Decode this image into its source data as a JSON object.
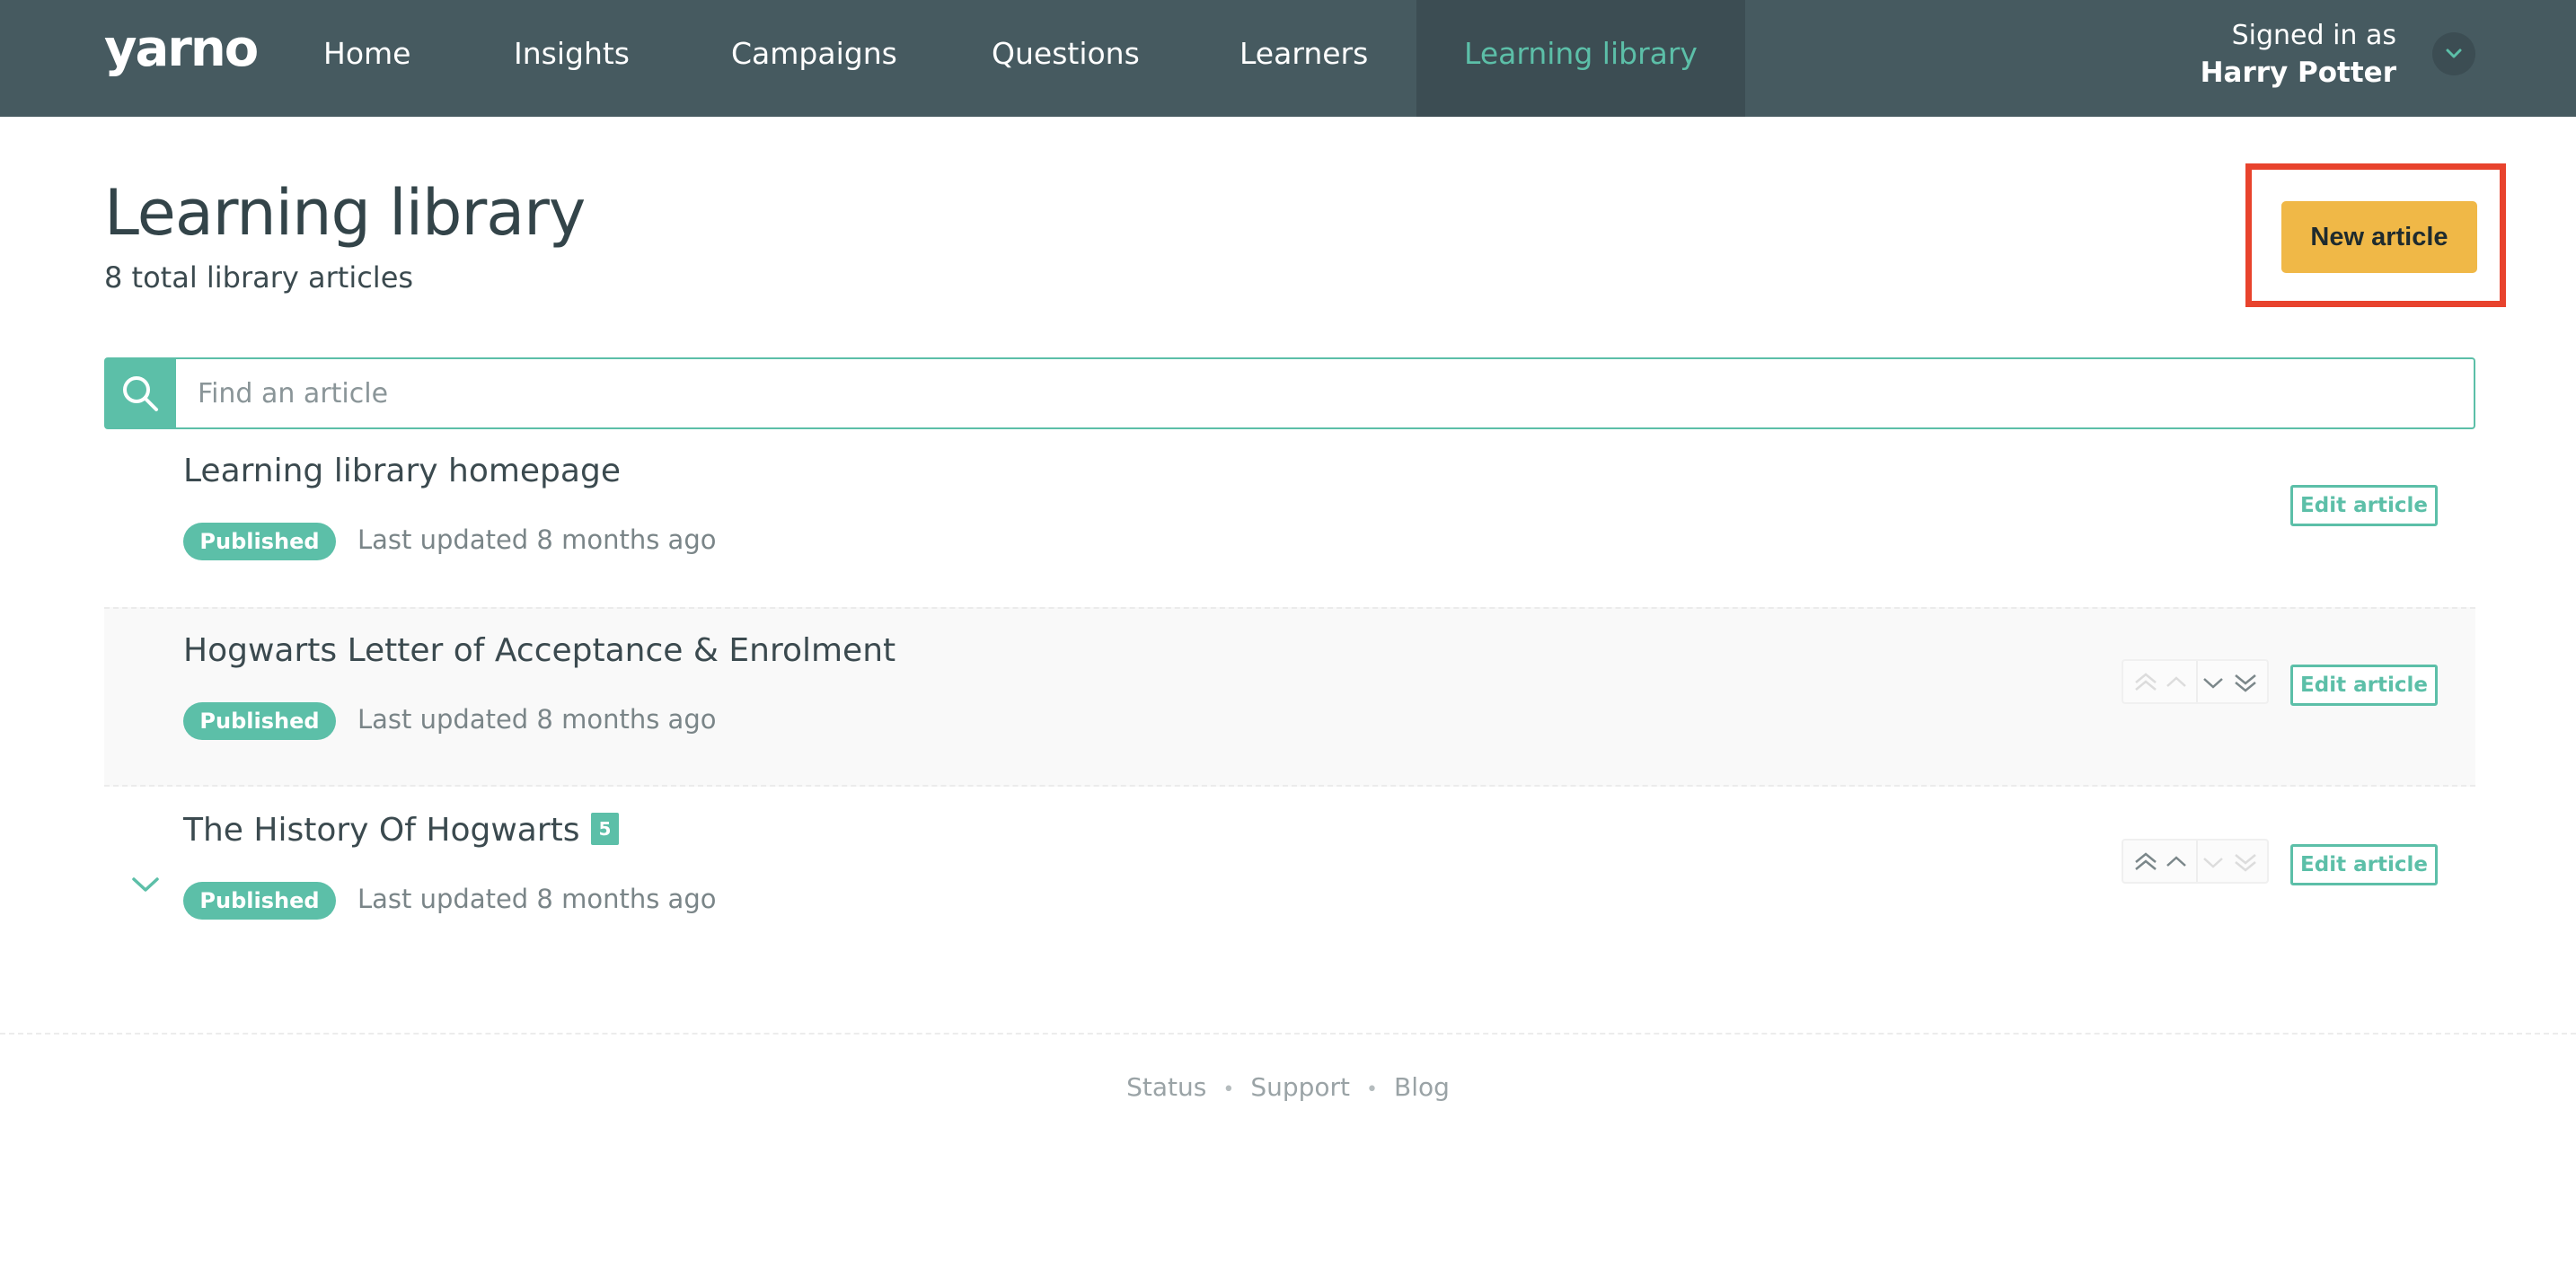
{
  "nav": {
    "logo": "yarno",
    "items": [
      {
        "label": "Home"
      },
      {
        "label": "Insights"
      },
      {
        "label": "Campaigns"
      },
      {
        "label": "Questions"
      },
      {
        "label": "Learners"
      },
      {
        "label": "Learning library",
        "active": true
      }
    ],
    "signed_in_label": "Signed in as",
    "user_name": "Harry Potter"
  },
  "header": {
    "title": "Learning library",
    "count_text": "8 total library articles",
    "new_article_label": "New article"
  },
  "search": {
    "placeholder": "Find an article",
    "value": ""
  },
  "articles": [
    {
      "title": "Learning library homepage",
      "status": "Published",
      "updated": "Last updated 8 months ago",
      "edit_label": "Edit article"
    },
    {
      "title": "Hogwarts Letter of Acceptance & Enrolment",
      "status": "Published",
      "updated": "Last updated 8 months ago",
      "edit_label": "Edit article"
    },
    {
      "title": "The History Of Hogwarts",
      "child_count": "5",
      "status": "Published",
      "updated": "Last updated 8 months ago",
      "edit_label": "Edit article"
    }
  ],
  "footer": {
    "links": [
      "Status",
      "Support",
      "Blog"
    ],
    "separator": "•"
  },
  "colors": {
    "nav_bg": "#465a60",
    "accent": "#5cbfa8",
    "primary_button": "#f0b847",
    "highlight": "#e8432d"
  },
  "icons": {
    "search": "search-icon",
    "user_menu": "chevron-down-icon",
    "expand": "chevron-down-icon",
    "move_top": "double-chevron-up-icon",
    "move_up": "chevron-up-icon",
    "move_down": "chevron-down-icon",
    "move_bottom": "double-chevron-down-icon"
  }
}
